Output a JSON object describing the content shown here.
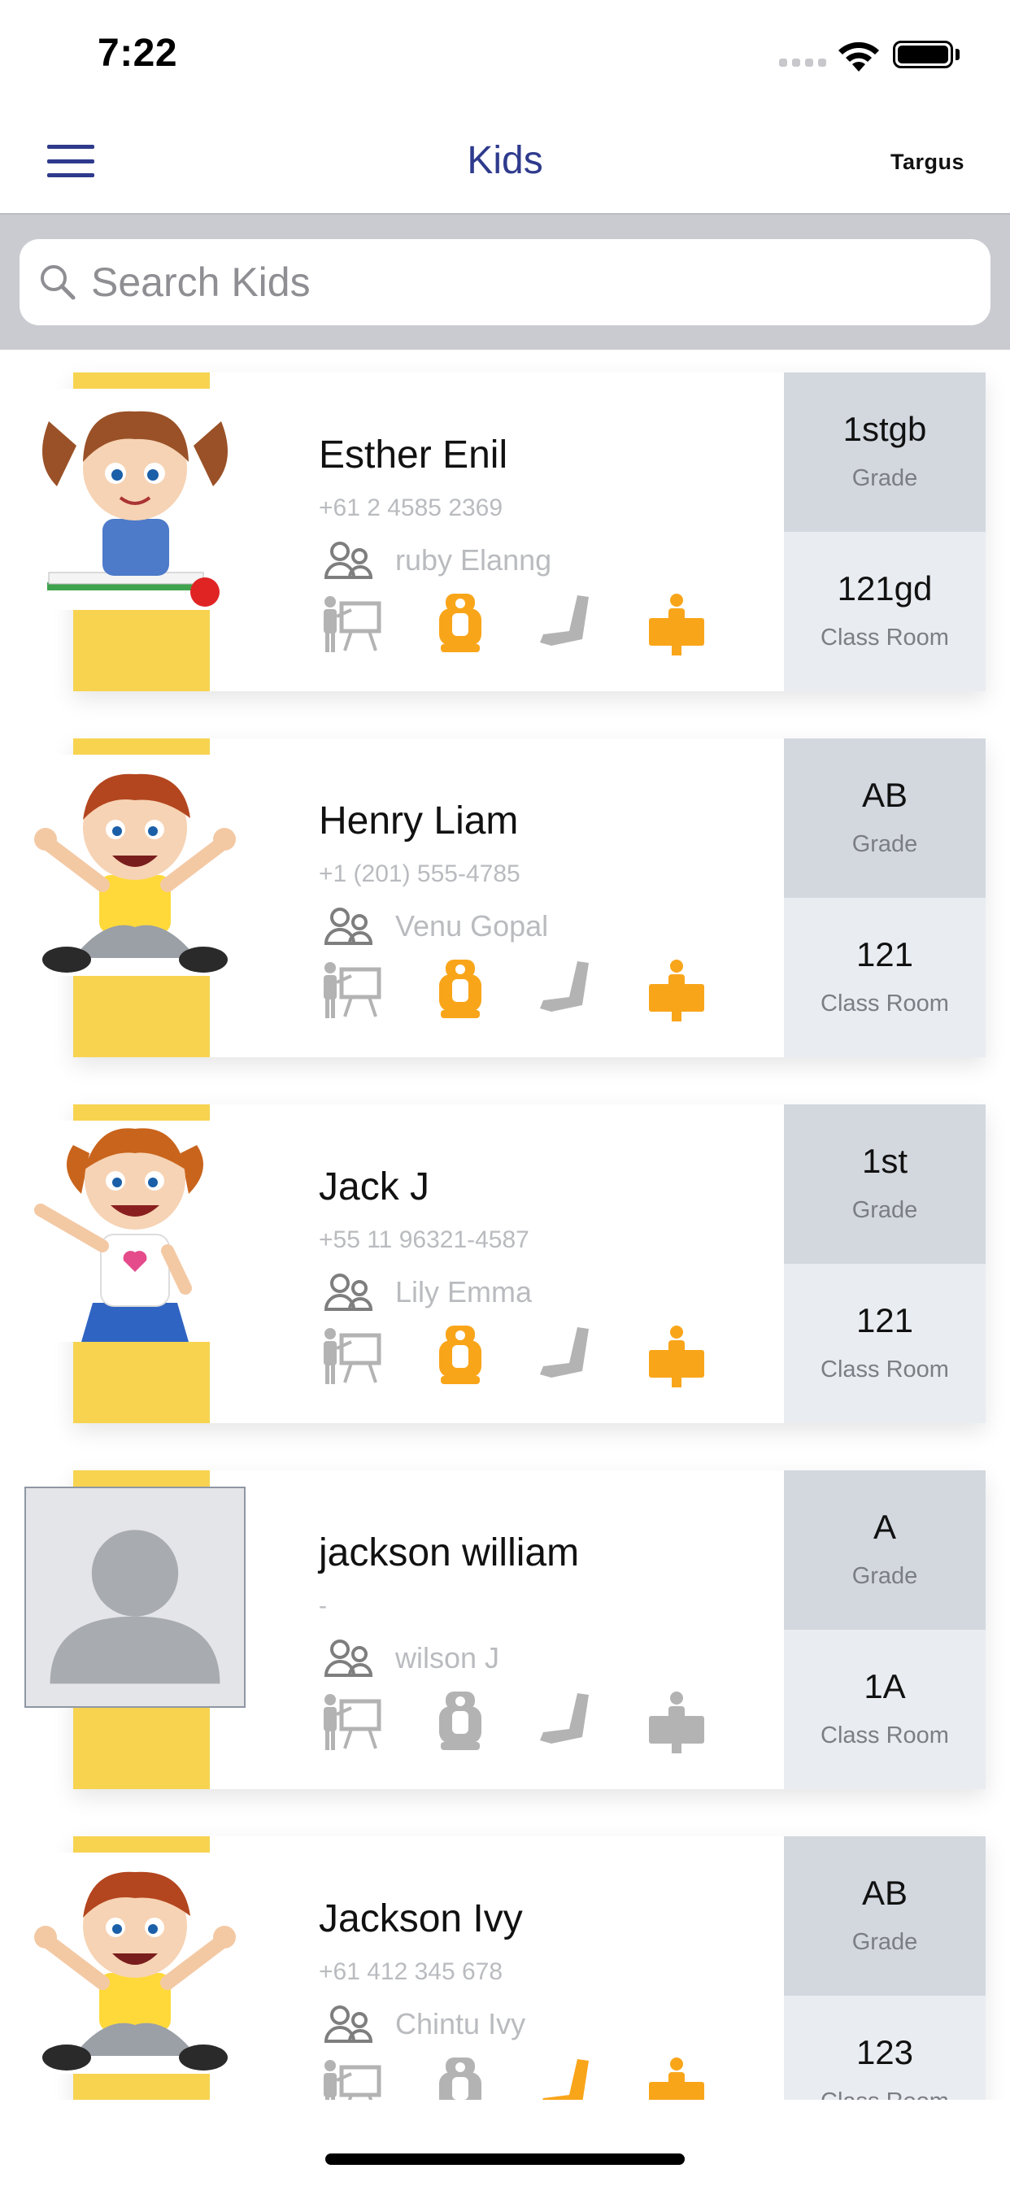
{
  "status_bar": {
    "time": "7:22"
  },
  "nav": {
    "title": "Kids",
    "brand": "Targus"
  },
  "search": {
    "placeholder": "Search Kids",
    "value": ""
  },
  "labels": {
    "grade": "Grade",
    "classroom": "Class Room"
  },
  "kids": [
    {
      "name": "Esther Enil",
      "phone": "+61 2 4585 2369",
      "parent": "ruby Elanng",
      "grade": "1stgb",
      "classroom": "121gd",
      "avatar": "girl-pigtails-studying",
      "trip_status": [
        false,
        true,
        false,
        true
      ]
    },
    {
      "name": "Henry Liam",
      "phone": "+1 (201) 555-4785",
      "parent": "Venu Gopal",
      "grade": "AB",
      "classroom": "121",
      "avatar": "boy-cheering",
      "trip_status": [
        false,
        true,
        false,
        true
      ]
    },
    {
      "name": "Jack J",
      "phone": "+55 11 96321-4587",
      "parent": "Lily Emma",
      "grade": "1st",
      "classroom": "121",
      "avatar": "girl-waving",
      "trip_status": [
        false,
        true,
        false,
        true
      ]
    },
    {
      "name": "jackson william",
      "phone": "-",
      "parent": "wilson J",
      "grade": "A",
      "classroom": "1A",
      "avatar": "default-person",
      "trip_status": [
        false,
        false,
        false,
        false
      ]
    },
    {
      "name": "Jackson Ivy",
      "phone": "+61 412 345 678",
      "parent": "Chintu Ivy",
      "grade": "AB",
      "classroom": "123",
      "avatar": "boy-cheering",
      "trip_status": [
        false,
        false,
        true,
        true
      ]
    }
  ],
  "colors": {
    "accent": "#2e3a8c",
    "active": "#f9a51a",
    "inactive": "#b3b3b3",
    "yellow_bar": "#f7d350"
  },
  "icons": [
    "menu-icon",
    "search-icon",
    "parents-icon",
    "classroom-icon",
    "car-seat-icon",
    "seat-icon",
    "desk-person-icon"
  ]
}
